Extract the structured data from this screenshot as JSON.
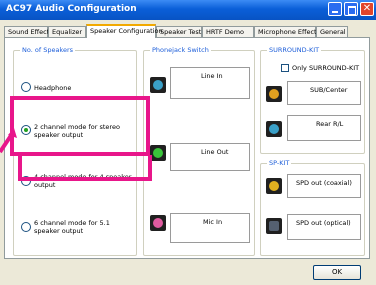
{
  "window": {
    "title": "AC97 Audio Configuration"
  },
  "tabs": [
    "Sound Effect",
    "Equalizer",
    "Speaker Configuration",
    "Speaker Test",
    "HRTF Demo",
    "Microphone Effect",
    "General"
  ],
  "active_tab": "Speaker Configuration",
  "speakers_group": {
    "label": "No. of Speakers",
    "options": [
      {
        "label": "Headphone",
        "checked": false
      },
      {
        "label": "2 channel mode for stereo speaker output",
        "checked": true
      },
      {
        "label": "4 channel mode for 4 speaker output",
        "checked": false
      },
      {
        "label": "6 channel mode for 5.1 speaker output",
        "checked": false
      }
    ]
  },
  "phonejack_group": {
    "label": "Phonejack Switch",
    "jacks": [
      {
        "label": "Line In",
        "color": "#3aa0c8"
      },
      {
        "label": "Line Out",
        "color": "#39c43a"
      },
      {
        "label": "Mic In",
        "color": "#e05ba0"
      }
    ]
  },
  "surround_group": {
    "label": "SURROUND-KIT",
    "checkbox_label": "Only SURROUND-KIT",
    "jacks": [
      {
        "label": "SUB/Center",
        "color": "#e0a020"
      },
      {
        "label": "Rear R/L",
        "color": "#3aa0c8"
      }
    ]
  },
  "spkit_group": {
    "label": "SP-KIT",
    "jacks": [
      {
        "label": "SPD out (coaxial)",
        "color": "#e0b020"
      },
      {
        "label": "SPD out (optical)",
        "color": "#556070"
      }
    ]
  },
  "buttons": {
    "ok": "OK"
  },
  "colors": {
    "highlight": "#e8168a",
    "title_bar": "#0a5fd8",
    "group_label": "#1d5ed9"
  }
}
